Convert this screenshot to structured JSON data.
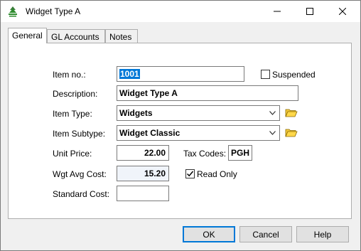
{
  "window": {
    "title": "Widget Type A",
    "icon": "tree-icon",
    "controls": [
      "minimize-icon",
      "maximize-icon",
      "close-icon"
    ]
  },
  "tabs": [
    {
      "label": "General",
      "active": true
    },
    {
      "label": "GL Accounts",
      "active": false
    },
    {
      "label": "Notes",
      "active": false
    }
  ],
  "form": {
    "item_no": {
      "label": "Item no.:",
      "value": "1001",
      "selected": true
    },
    "suspended": {
      "label": "Suspended",
      "checked": false
    },
    "description": {
      "label": "Description:",
      "value": "Widget Type A"
    },
    "item_type": {
      "label": "Item Type:",
      "value": "Widgets"
    },
    "item_subtype": {
      "label": "Item Subtype:",
      "value": "Widget Classic"
    },
    "unit_price": {
      "label": "Unit Price:",
      "value": "22.00"
    },
    "tax_codes": {
      "label": "Tax Codes:",
      "value": "PGH"
    },
    "wgt_avg_cost": {
      "label": "Wgt Avg Cost:",
      "value": "15.20"
    },
    "read_only": {
      "label": "Read Only",
      "checked": true
    },
    "standard_cost": {
      "label": "Standard Cost:",
      "value": ""
    }
  },
  "buttons": {
    "ok": "OK",
    "cancel": "Cancel",
    "help": "Help"
  },
  "colors": {
    "selection": "#0078d7",
    "window_bg": "#f0f0f0",
    "folder": "#e8b400"
  }
}
